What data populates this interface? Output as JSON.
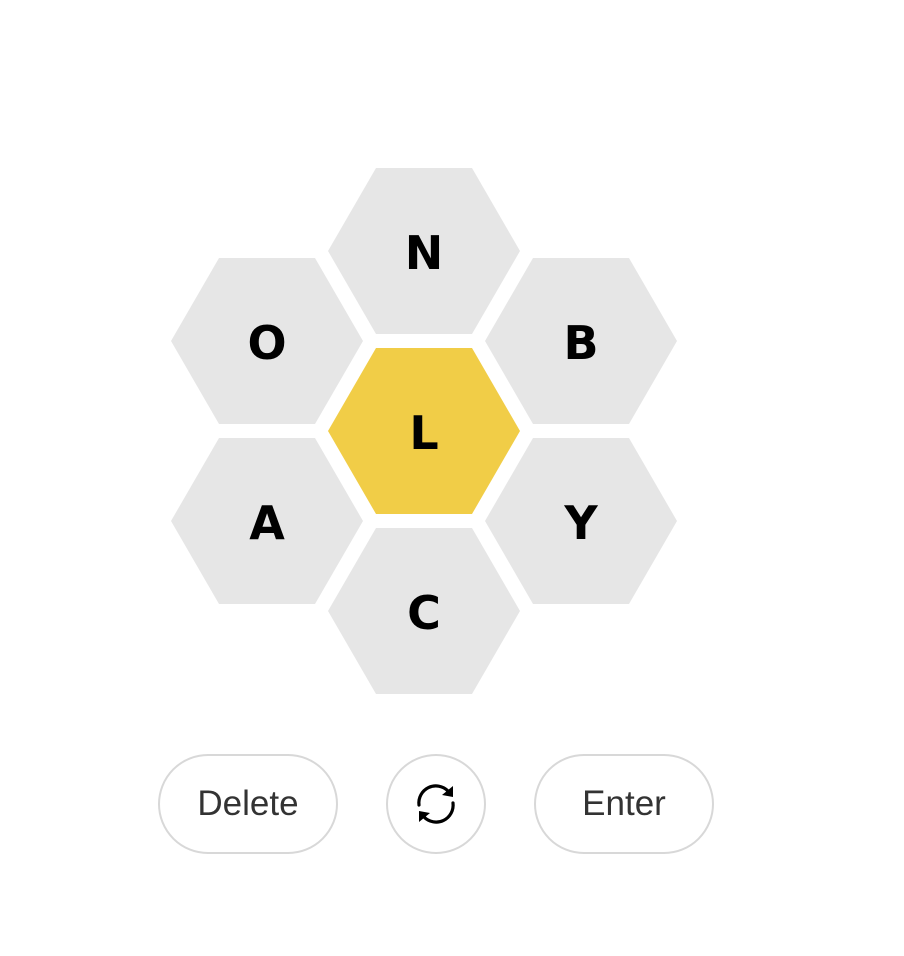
{
  "hive": {
    "center_letter": "L",
    "outer_letters": {
      "top": "N",
      "upper_left": "O",
      "upper_right": "B",
      "lower_left": "A",
      "lower_right": "Y",
      "bottom": "C"
    },
    "center_color": "#f1cd47",
    "outer_color": "#e6e6e6"
  },
  "controls": {
    "delete_label": "Delete",
    "shuffle_icon": "shuffle-icon",
    "enter_label": "Enter"
  }
}
